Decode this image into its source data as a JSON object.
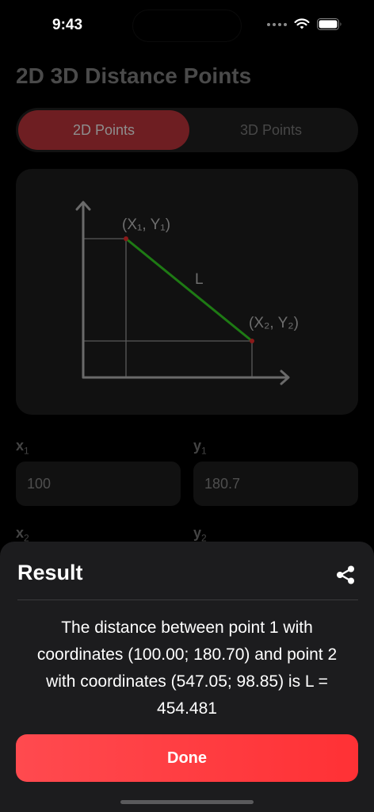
{
  "status_bar": {
    "time": "9:43"
  },
  "page": {
    "title": "2D 3D Distance Points"
  },
  "tabs": [
    {
      "label": "2D Points",
      "active": true
    },
    {
      "label": "3D Points",
      "active": false
    }
  ],
  "diagram": {
    "point1_label": "(X₁, Y₁)",
    "point2_label": "(X₂, Y₂)",
    "line_label": "L",
    "line_color": "#1e7a14",
    "point_color": "#8b1a1a"
  },
  "fields": {
    "x1": {
      "label": "x",
      "sub": "1",
      "value": "100"
    },
    "y1": {
      "label": "y",
      "sub": "1",
      "value": "180.7"
    },
    "x2": {
      "label": "x",
      "sub": "2"
    },
    "y2": {
      "label": "y",
      "sub": "2"
    }
  },
  "result_sheet": {
    "title": "Result",
    "text": "The distance between point 1 with coordinates (100.00; 180.70) and point 2 with coordinates (547.05; 98.85) is L = 454.481",
    "done_label": "Done",
    "share_icon": "share-icon",
    "accent": "#ff3b3f"
  }
}
